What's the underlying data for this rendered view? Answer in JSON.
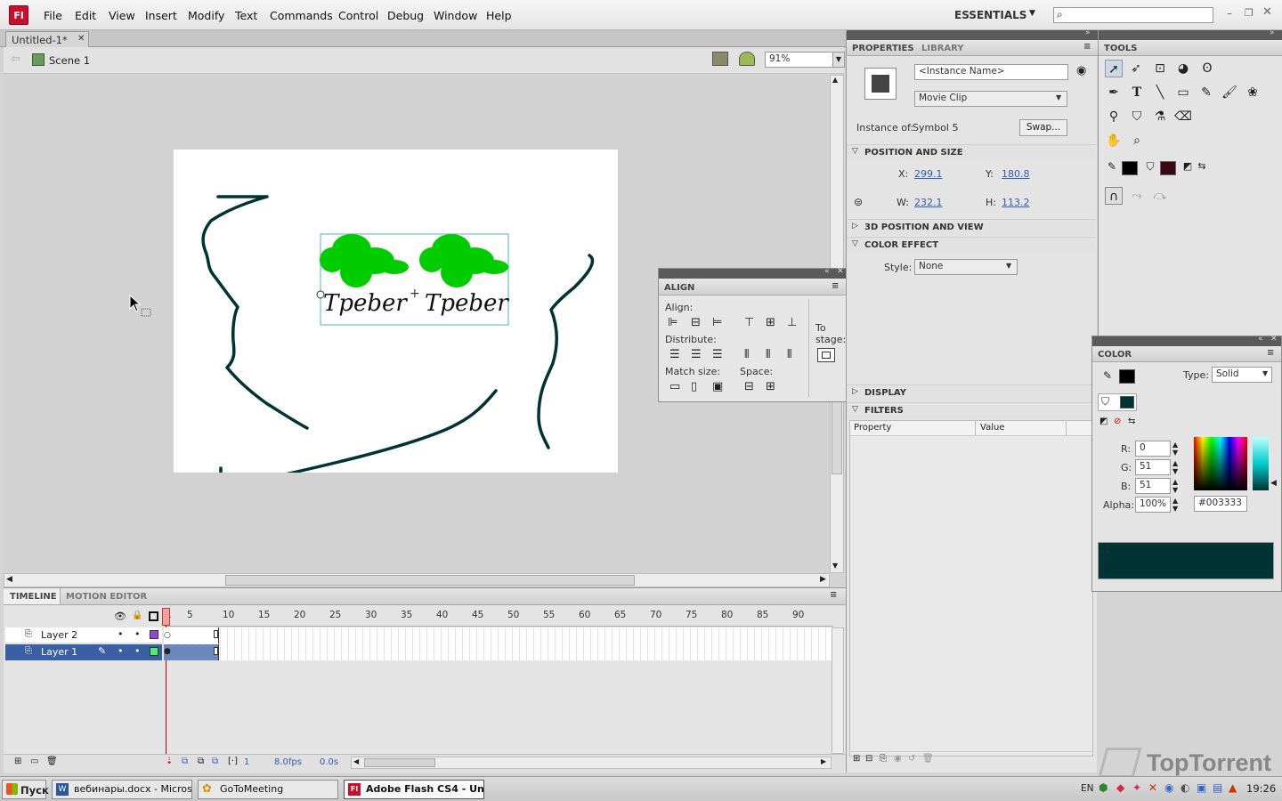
{
  "app": {
    "logo": "Fl"
  },
  "menu": [
    "File",
    "Edit",
    "View",
    "Insert",
    "Modify",
    "Text",
    "Commands",
    "Control",
    "Debug",
    "Window",
    "Help"
  ],
  "workspace": {
    "label": "ESSENTIALS",
    "search_placeholder": ""
  },
  "document": {
    "tab": "Untitled-1*",
    "scene": "Scene 1",
    "zoom": "91%"
  },
  "stage": {
    "text_left": "Tpeber",
    "text_right": "Tpeber"
  },
  "align": {
    "title": "ALIGN",
    "align_label": "Align:",
    "distribute_label": "Distribute:",
    "match_label": "Match size:",
    "space_label": "Space:",
    "to_stage_1": "To",
    "to_stage_2": "stage:"
  },
  "properties": {
    "tab_properties": "PROPERTIES",
    "tab_library": "LIBRARY",
    "instance_name_placeholder": "<Instance Name>",
    "symbol_type": "Movie Clip",
    "instance_of_label": "Instance of:",
    "instance_of": "Symbol 5",
    "swap": "Swap...",
    "position_size": "POSITION AND SIZE",
    "x_label": "X:",
    "x": "299.1",
    "y_label": "Y:",
    "y": "180.8",
    "w_label": "W:",
    "w": "232.1",
    "h_label": "H:",
    "h": "113.2",
    "pos3d": "3D POSITION AND VIEW",
    "color_effect": "COLOR EFFECT",
    "style_label": "Style:",
    "style": "None",
    "display": "DISPLAY",
    "filters": "FILTERS",
    "col_property": "Property",
    "col_value": "Value"
  },
  "tools": {
    "title": "TOOLS"
  },
  "color": {
    "title": "COLOR",
    "type_label": "Type:",
    "type": "Solid",
    "r_label": "R:",
    "r": "0",
    "g_label": "G:",
    "g": "51",
    "b_label": "B:",
    "b": "51",
    "alpha_label": "Alpha:",
    "alpha": "100%",
    "hex": "#003333",
    "swatch": "#003333"
  },
  "timeline": {
    "tab_timeline": "TIMELINE",
    "tab_motion": "MOTION EDITOR",
    "frame_numbers": [
      "1",
      "5",
      "10",
      "15",
      "20",
      "25",
      "30",
      "35",
      "40",
      "45",
      "50",
      "55",
      "60",
      "65",
      "70",
      "75",
      "80",
      "85",
      "90"
    ],
    "layers": [
      "Layer 2",
      "Layer 1"
    ],
    "current_frame": "1",
    "fps": "8.0fps",
    "time": "0.0s"
  },
  "taskbar": {
    "start": "Пуск",
    "tasks": [
      "вебинары.docx - Micros...",
      "GoToMeeting",
      "Adobe Flash CS4 - Unt..."
    ],
    "lang": "EN",
    "clock": "19:26"
  },
  "watermark": "TopTorrent",
  "colors": {
    "accent": "#c8102e",
    "stroke": "#003333",
    "fill": "#00cc00"
  }
}
